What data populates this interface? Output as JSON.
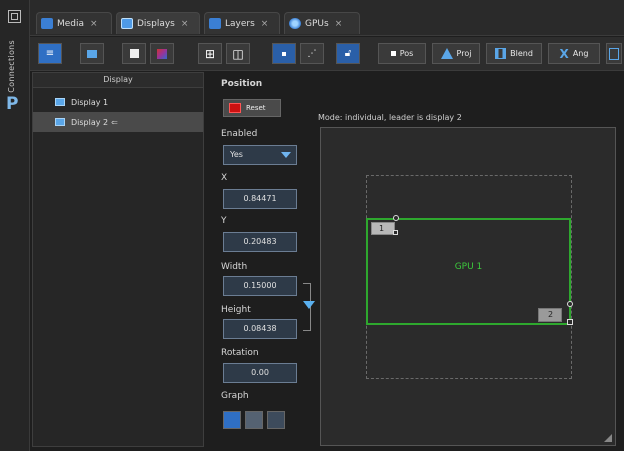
{
  "sidebar": {
    "connections_label": "Connections",
    "p_label": "P"
  },
  "tabs": [
    {
      "label": "Media",
      "close": "×"
    },
    {
      "label": "Displays",
      "close": "×"
    },
    {
      "label": "Layers",
      "close": "×"
    },
    {
      "label": "GPUs",
      "close": "×"
    }
  ],
  "toolbar": {
    "pos_label": "Pos",
    "proj_label": "Proj",
    "blend_label": "Blend",
    "ang_label": "Ang"
  },
  "display_list": {
    "header": "Display",
    "items": [
      {
        "label": "Display 1"
      },
      {
        "label": "Display 2"
      }
    ]
  },
  "properties": {
    "position_label": "Position",
    "reset_label": "Reset",
    "enabled_label": "Enabled",
    "enabled_value": "Yes",
    "x_label": "X",
    "x_value": "0.84471",
    "y_label": "Y",
    "y_value": "0.20483",
    "width_label": "Width",
    "width_value": "0.15000",
    "height_label": "Height",
    "height_value": "0.08438",
    "rotation_label": "Rotation",
    "rotation_value": "0.00",
    "graph_label": "Graph"
  },
  "canvas": {
    "mode_text": "Mode: individual, leader is display 2",
    "gpu_label": "GPU 1",
    "display1_badge": "1",
    "display2_badge": "2"
  },
  "colors": {
    "accent_blue": "#5aa6e8",
    "gpu_green": "#2ea82e",
    "reset_red": "#cc1111"
  }
}
